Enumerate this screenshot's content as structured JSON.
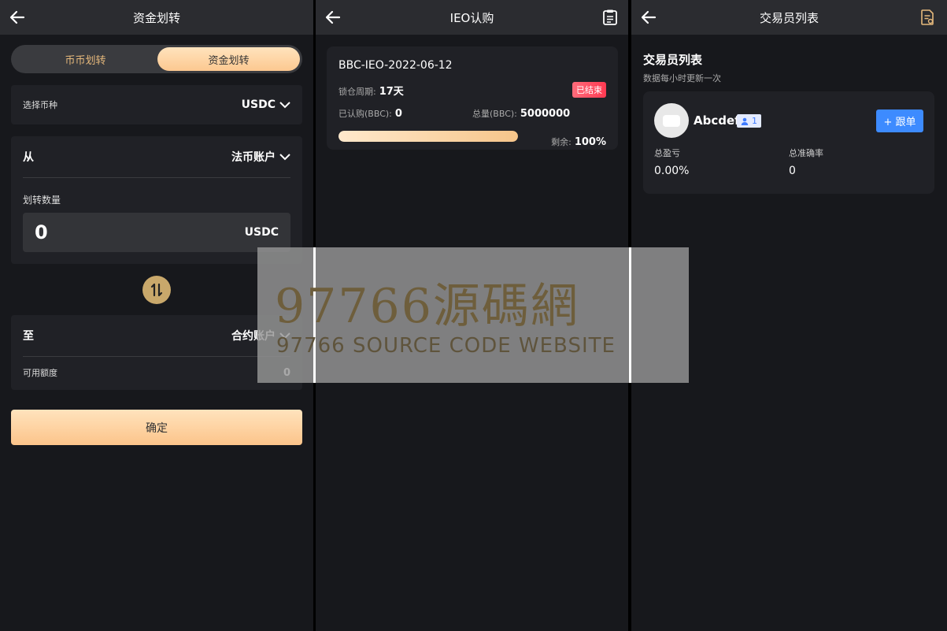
{
  "panel1": {
    "title": "资金划转",
    "tabs": [
      "币币划转",
      "资金划转"
    ],
    "active_tab": 1,
    "coin_label": "选择币种",
    "coin_value": "USDC",
    "from_label": "从",
    "from_value": "法币账户",
    "amount_label": "划转数量",
    "amount_value": "0",
    "amount_unit": "USDC",
    "to_label": "至",
    "to_value": "合约账户",
    "available_label": "可用额度",
    "available_value": "0",
    "confirm_label": "确定"
  },
  "panel2": {
    "title": "IEO认购",
    "item": {
      "name": "BBC-IEO-2022-06-12",
      "lock_label": "锁仓周期:",
      "lock_value": "17天",
      "status": "已结束",
      "subscribed_label": "已认购(BBC):",
      "subscribed_value": "0",
      "total_label": "总量(BBC):",
      "total_value": "5000000",
      "remaining_label": "剩余:",
      "remaining_value": "100%",
      "progress": 1.0
    }
  },
  "panel3": {
    "title": "交易员列表",
    "heading": "交易员列表",
    "subheading": "数据每小时更新一次",
    "trader": {
      "name": "Abcdef",
      "followers": "1",
      "follow_label": "+ 跟单",
      "pnl_label": "总盈亏",
      "pnl_value": "0.00%",
      "accuracy_label": "总准确率",
      "accuracy_value": "0"
    }
  },
  "watermark": {
    "main": "97766源碼網",
    "sub": "97766 SOURCE CODE WEBSITE"
  },
  "colors": {
    "accent_gold": "#fcc890",
    "follow_blue": "#3d8bff",
    "status_red": "#ff3a52",
    "panel_bg": "#17181c",
    "card_bg": "#202126"
  }
}
